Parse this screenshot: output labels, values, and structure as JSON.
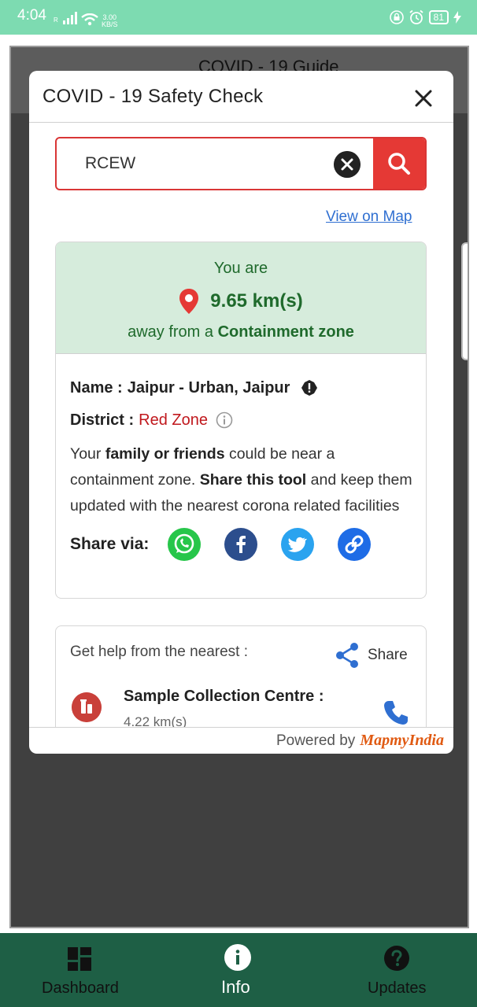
{
  "status_bar": {
    "time": "4:04",
    "net_label": "R",
    "speed_value": "3.00",
    "speed_unit": "KB/S",
    "battery": "81"
  },
  "background_app": {
    "title": "COVID - 19 Guide"
  },
  "modal": {
    "title": "COVID - 19 Safety Check",
    "search": {
      "value": "RCEW"
    },
    "view_on_map": "View on Map",
    "result": {
      "you_are": "You are",
      "distance": "9.65 km(s)",
      "away_prefix": "away from a",
      "away_zone": "Containment zone",
      "name_label": "Name :",
      "name_value": "Jaipur - Urban, Jaipur",
      "district_label": "District :",
      "district_value": "Red Zone",
      "desc_part1": "Your ",
      "desc_bold1": "family or friends",
      "desc_part2": " could be near a containment zone. ",
      "desc_bold2": "Share this tool",
      "desc_part3": " and keep them updated with the nearest corona related facilities",
      "share_via": "Share via:",
      "share_icons": [
        "whatsapp-icon",
        "facebook-icon",
        "twitter-icon",
        "link-icon"
      ]
    },
    "help": {
      "title": "Get help from the nearest :",
      "share_label": "Share",
      "facility_name": "Sample Collection Centre :",
      "facility_distance": "4.22 km(s)"
    },
    "footer": {
      "powered_by": "Powered by",
      "brand": "MapmyIndia"
    }
  },
  "bottom_nav": {
    "items": [
      {
        "label": "Dashboard",
        "icon": "dashboard-icon"
      },
      {
        "label": "Info",
        "icon": "info-icon"
      },
      {
        "label": "Updates",
        "icon": "help-icon"
      }
    ]
  },
  "colors": {
    "status_bar": "#7ddbb1",
    "accent_red": "#e53935",
    "zone_green_bg": "#d6ecdc",
    "zone_green_text": "#1f6a2c",
    "bottom_nav": "#1e5f45"
  }
}
